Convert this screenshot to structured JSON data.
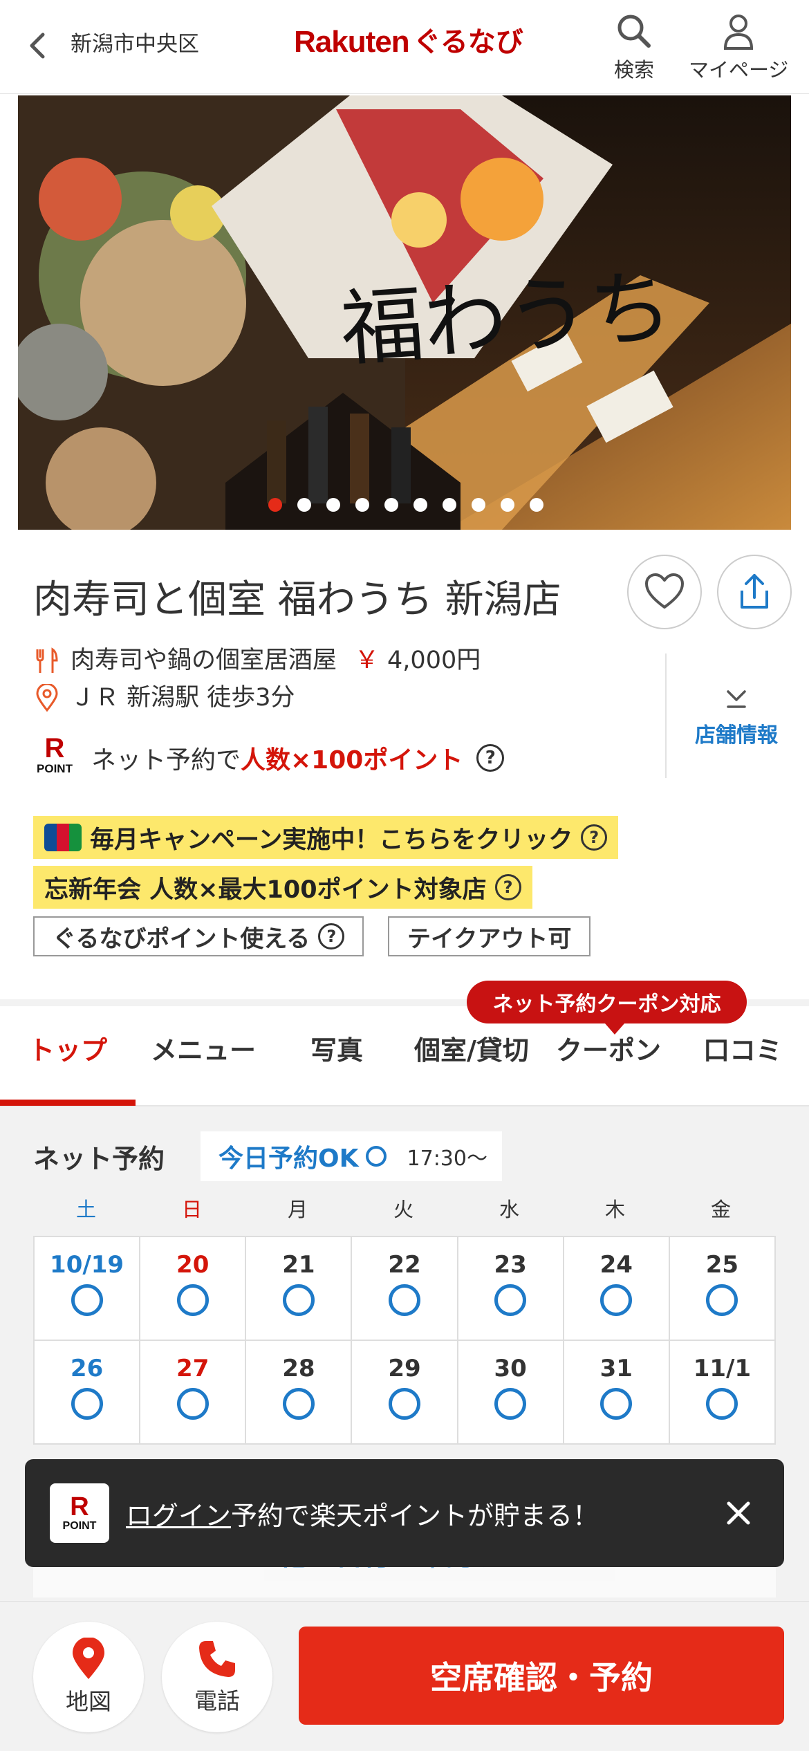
{
  "header": {
    "area": "新潟市中央区",
    "logo_rakuten": "Rakuten",
    "logo_gurunavi": "ぐるなび",
    "search_label": "検索",
    "mypage_label": "マイページ"
  },
  "hero": {
    "slide_count": 10,
    "active_slide": 1,
    "sign_text": "福わうち"
  },
  "shop": {
    "name": "肉寿司と個室 福わうち 新潟店",
    "genre": "肉寿司や鍋の個室居酒屋",
    "yen_mark": "￥",
    "budget": "4,000円",
    "access": "ＪＲ 新潟駅 徒歩3分",
    "shop_info_label": "店舗情報"
  },
  "points": {
    "r_mark": "R",
    "point_label": "POINT",
    "prefix": "ネット予約で",
    "highlight": "人数×100ポイント",
    "help": "?"
  },
  "tags": {
    "campaign": "毎月キャンペーン実施中！こちらをクリック",
    "bonenkai": "忘新年会 人数×最大100ポイント対象店",
    "gurunavi_point": "ぐるなびポイント使える",
    "takeout": "テイクアウト可",
    "help": "?"
  },
  "tabs": {
    "coupon_badge": "ネット予約クーポン対応",
    "items": [
      "トップ",
      "メニュー",
      "写真",
      "個室/貸切",
      "クーポン",
      "口コミ"
    ],
    "active_index": 0
  },
  "reservation": {
    "title": "ネット予約",
    "today_ok": "今日予約OK",
    "today_time": "17:30〜",
    "weekdays": [
      "土",
      "日",
      "月",
      "火",
      "水",
      "木",
      "金"
    ],
    "week1": [
      "10/19",
      "20",
      "21",
      "22",
      "23",
      "24",
      "25"
    ],
    "week2": [
      "26",
      "27",
      "28",
      "29",
      "30",
      "31",
      "11/1"
    ],
    "other_dates": "他の日付を確認する"
  },
  "toast": {
    "r_mark": "R",
    "point_label": "POINT",
    "login": "ログイン",
    "message": "予約で楽天ポイントが貯まる！"
  },
  "bottom_bar": {
    "map_label": "地図",
    "phone_label": "電話",
    "reserve_label": "空席確認・予約"
  },
  "colors": {
    "brand_red": "#bf0000",
    "accent_red": "#e52b18",
    "link_blue": "#1e7ac8",
    "tag_yellow": "#fde86c"
  }
}
